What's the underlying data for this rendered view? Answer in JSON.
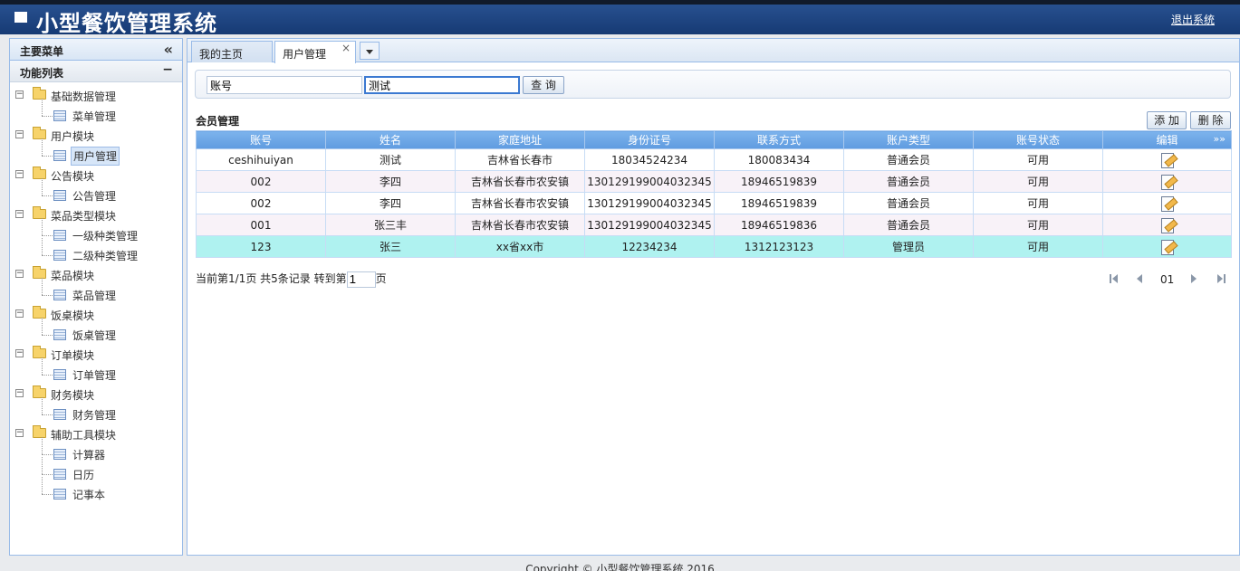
{
  "header": {
    "title": "小型餐饮管理系统",
    "logout_label": "退出系统"
  },
  "left": {
    "panel_title": "主要菜单",
    "collapse_glyph": "«",
    "section_title": "功能列表",
    "section_toggle": "−",
    "tree": [
      {
        "label": "基础数据管理",
        "children": [
          "菜单管理"
        ]
      },
      {
        "label": "用户模块",
        "children": [
          "用户管理"
        ]
      },
      {
        "label": "公告模块",
        "children": [
          "公告管理"
        ]
      },
      {
        "label": "菜品类型模块",
        "children": [
          "一级种类管理",
          "二级种类管理"
        ]
      },
      {
        "label": "菜品模块",
        "children": [
          "菜品管理"
        ]
      },
      {
        "label": "饭桌模块",
        "children": [
          "饭桌管理"
        ]
      },
      {
        "label": "订单模块",
        "children": [
          "订单管理"
        ]
      },
      {
        "label": "财务模块",
        "children": [
          "财务管理"
        ]
      },
      {
        "label": "辅助工具模块",
        "children": [
          "计算器",
          "日历",
          "记事本"
        ]
      }
    ],
    "selected_item": "用户管理"
  },
  "tabs": [
    {
      "label": "我的主页",
      "active": false
    },
    {
      "label": "用户管理",
      "active": true,
      "close": "×"
    }
  ],
  "search": {
    "account_value": "账号",
    "name_value": "测试",
    "query_label": "查 询"
  },
  "section": {
    "title": "会员管理",
    "add_label": "添 加",
    "delete_label": "删 除"
  },
  "table": {
    "headers": [
      "账号",
      "姓名",
      "家庭地址",
      "身份证号",
      "联系方式",
      "账户类型",
      "账号状态",
      "编辑"
    ],
    "rows": [
      [
        "ceshihuiyan",
        "测试",
        "吉林省长春市",
        "18034524234",
        "180083434",
        "普通会员",
        "可用"
      ],
      [
        "002",
        "李四",
        "吉林省长春市农安镇",
        "130129199004032345",
        "18946519839",
        "普通会员",
        "可用"
      ],
      [
        "002",
        "李四",
        "吉林省长春市农安镇",
        "130129199004032345",
        "18946519839",
        "普通会员",
        "可用"
      ],
      [
        "001",
        "张三丰",
        "吉林省长春市农安镇",
        "130129199004032345",
        "18946519836",
        "普通会员",
        "可用"
      ],
      [
        "123",
        "张三",
        "xx省xx市",
        "12234234",
        "1312123123",
        "管理员",
        "可用"
      ]
    ],
    "expand_glyph": "»»"
  },
  "pager": {
    "info": "当前第1/1页 共5条记录 转到第",
    "goto_value": "1",
    "suffix": "页",
    "current_page": "01"
  },
  "footer": {
    "text": "Copyright © 小型餐饮管理系统 2016"
  },
  "colors": {
    "header_bg": "#1d4580",
    "grid_header": "#6aa6e6",
    "highlight_row": "#aff2f0"
  }
}
